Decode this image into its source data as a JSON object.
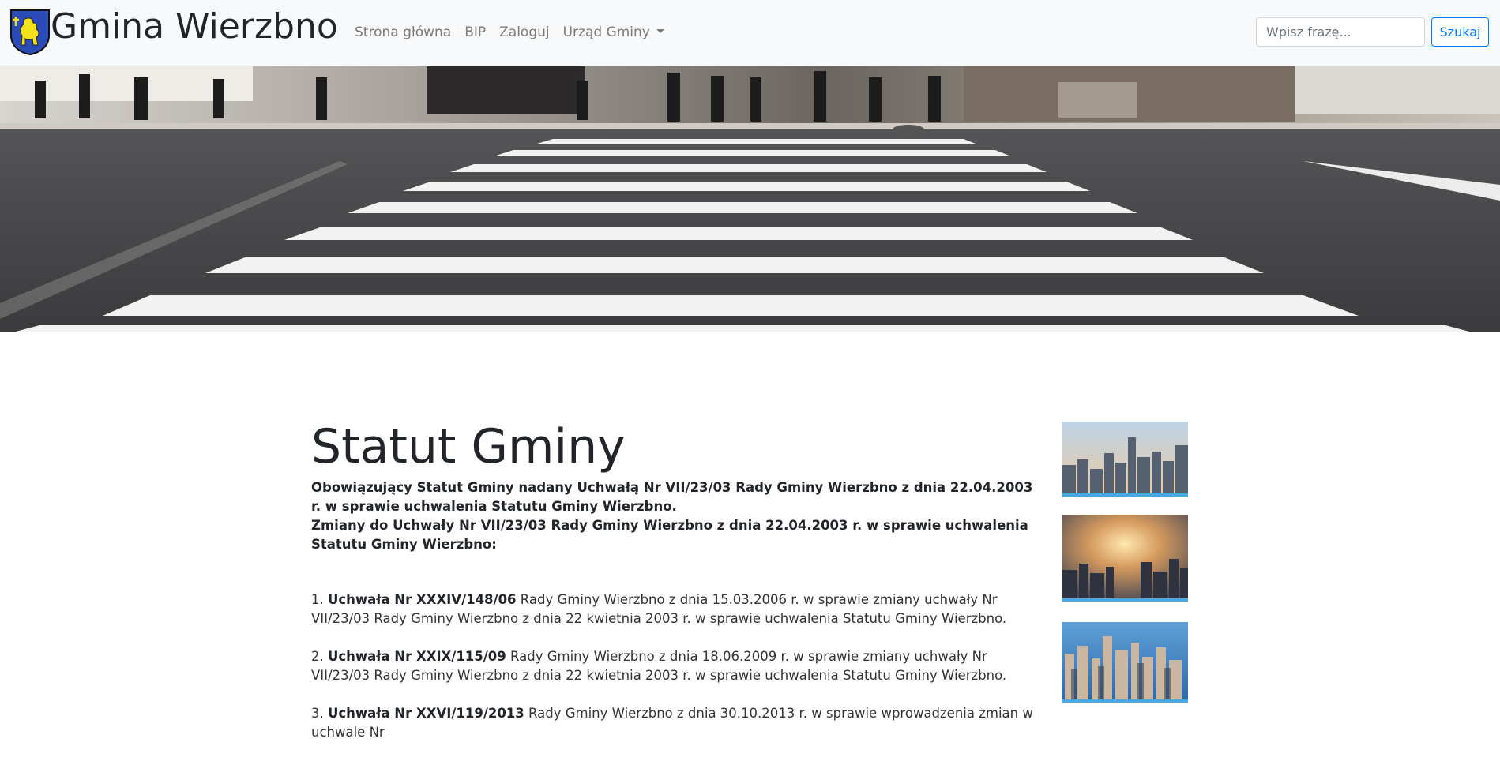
{
  "header": {
    "brand": "Gmina Wierzbno",
    "logo_icon": "coat-of-arms-icon",
    "nav": [
      {
        "label": "Strona główna"
      },
      {
        "label": "BIP"
      },
      {
        "label": "Zaloguj"
      },
      {
        "label": "Urząd Gminy",
        "dropdown": true
      }
    ],
    "search": {
      "placeholder": "Wpisz frazę...",
      "value": "",
      "button": "Szukaj"
    }
  },
  "main": {
    "title": "Statut Gminy",
    "intro": [
      "Obowiązujący Statut Gminy nadany Uchwałą Nr VII/23/03 Rady Gminy Wierzbno z dnia 22.04.2003 r. w sprawie uchwalenia Statutu Gminy Wierzbno.",
      "Zmiany do Uchwały Nr VII/23/03 Rady Gminy Wierzbno z dnia 22.04.2003 r. w sprawie uchwalenia Statutu Gminy Wierzbno:"
    ],
    "items": [
      {
        "num": "1.",
        "ref": "Uchwała Nr XXXIV/148/06",
        "text": "Rady Gminy Wierzbno z dnia 15.03.2006 r. w sprawie zmiany uchwały Nr VII/23/03 Rady Gminy Wierzbno z dnia 22 kwietnia 2003 r. w sprawie uchwalenia Statutu Gminy Wierzbno."
      },
      {
        "num": "2.",
        "ref": "Uchwała Nr XXIX/115/09",
        "text": "Rady Gminy Wierzbno z dnia 18.06.2009 r. w sprawie zmiany uchwały Nr VII/23/03 Rady Gminy Wierzbno z dnia 22 kwietnia 2003 r. w sprawie uchwalenia Statutu Gminy Wierzbno."
      },
      {
        "num": "3.",
        "ref": "Uchwała Nr XXVI/119/2013",
        "text": "Rady Gminy Wierzbno z dnia 30.10.2013 r. w sprawie wprowadzenia zmian w uchwale Nr"
      }
    ]
  },
  "colors": {
    "accent": "#007bff",
    "thumb_border": "#48a8e0",
    "navbar_bg": "#f8f9fa"
  }
}
